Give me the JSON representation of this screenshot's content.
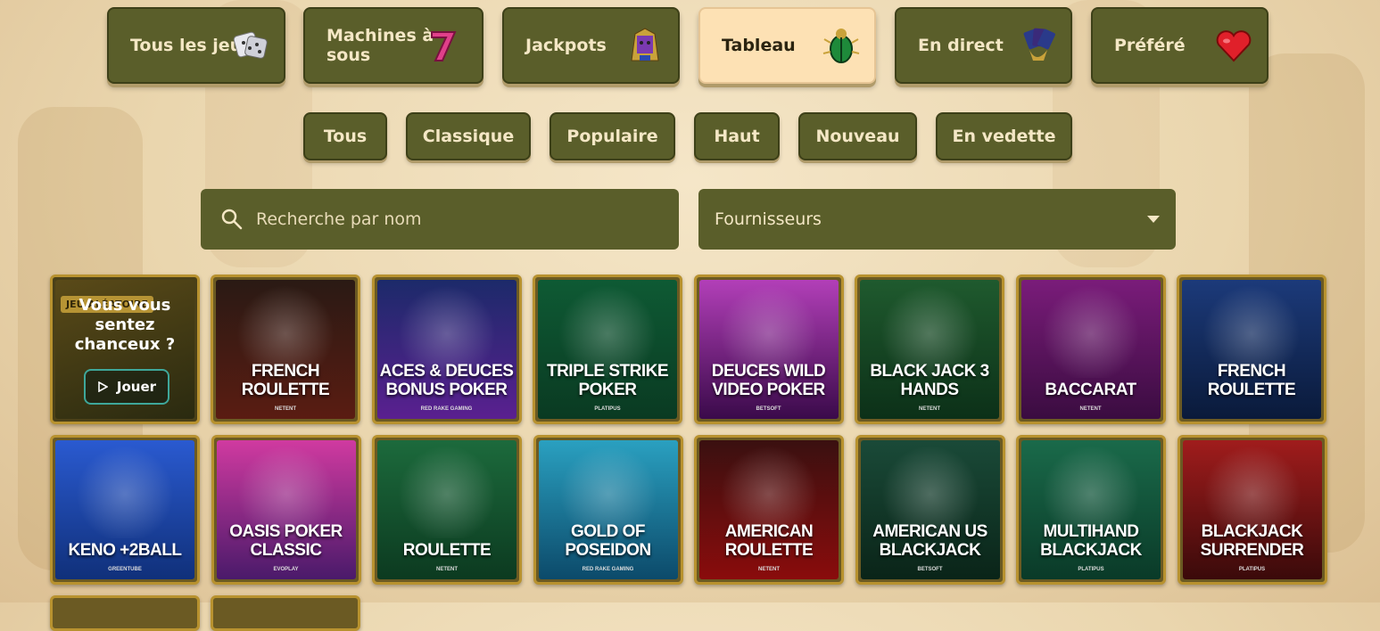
{
  "categories": [
    {
      "label": "Tous les jeux",
      "icon": "dice-icon"
    },
    {
      "label": "Machines à sous",
      "icon": "seven-icon"
    },
    {
      "label": "Jackpots",
      "icon": "pharaoh-icon"
    },
    {
      "label": "Tableau",
      "icon": "scarab-icon",
      "active": true
    },
    {
      "label": "En direct",
      "icon": "cards-hand-icon"
    },
    {
      "label": "Préféré",
      "icon": "heart-icon"
    }
  ],
  "filters": [
    "Tous",
    "Classique",
    "Populaire",
    "Haut",
    "Nouveau",
    "En vedette"
  ],
  "search": {
    "placeholder": "Recherche par nom"
  },
  "providers_select": {
    "label": "Fournisseurs"
  },
  "promo": {
    "badge": "JEU ALÉATOIRE",
    "text": "Vous vous sentez chanceux ?",
    "button": "Jouer"
  },
  "games_row1": [
    {
      "title": "FRENCH ROULETTE",
      "provider": "NETENT",
      "colors": [
        "#2a1a14",
        "#5a1c12"
      ]
    },
    {
      "title": "ACES & DEUCES BONUS POKER",
      "provider": "RED RAKE GAMING",
      "colors": [
        "#1c2a6a",
        "#5a2090"
      ]
    },
    {
      "title": "TRIPLE STRIKE POKER",
      "provider": "PLATIPUS",
      "colors": [
        "#0e5a34",
        "#0a3a22"
      ]
    },
    {
      "title": "DEUCES WILD VIDEO POKER",
      "provider": "BETSOFT",
      "colors": [
        "#b23fb8",
        "#3a0a4a"
      ]
    },
    {
      "title": "BLACK JACK 3 HANDS",
      "provider": "NETENT",
      "colors": [
        "#1f5a2e",
        "#0c3018"
      ]
    },
    {
      "title": "BACCARAT",
      "provider": "NETENT",
      "colors": [
        "#7a1c7a",
        "#3a0c40"
      ]
    },
    {
      "title": "FRENCH ROULETTE",
      "provider": "",
      "colors": [
        "#1c3a7a",
        "#0a1a3a"
      ]
    }
  ],
  "games_row2": [
    {
      "title": "KENO +2BALL",
      "provider": "GREENTUBE",
      "colors": [
        "#2a5ad0",
        "#10307a"
      ]
    },
    {
      "title": "OASIS POKER CLASSIC",
      "provider": "EVOPLAY",
      "colors": [
        "#d03aa0",
        "#4a1a6a"
      ]
    },
    {
      "title": "ROULETTE",
      "provider": "NETENT",
      "colors": [
        "#1c6a3c",
        "#0c3a20"
      ]
    },
    {
      "title": "GOLD OF POSEIDON",
      "provider": "RED RAKE GAMING",
      "colors": [
        "#2aa0c0",
        "#0c4a6a"
      ]
    },
    {
      "title": "AMERICAN ROULETTE",
      "provider": "NETENT",
      "colors": [
        "#3a1010",
        "#8a0c0c"
      ]
    },
    {
      "title": "AMERICAN US BLACKJACK",
      "provider": "BETSOFT",
      "colors": [
        "#1a4a38",
        "#0a2418"
      ]
    },
    {
      "title": "MULTIHAND BLACKJACK",
      "provider": "PLATIPUS",
      "colors": [
        "#1a6a4a",
        "#0a3a28"
      ]
    },
    {
      "title": "BLACKJACK SURRENDER",
      "provider": "PLATIPUS",
      "colors": [
        "#a01c1c",
        "#3a0a0a"
      ]
    }
  ]
}
